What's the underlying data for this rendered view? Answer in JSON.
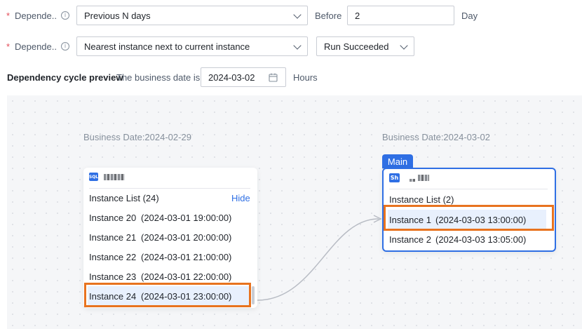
{
  "form": {
    "row1": {
      "required_mark": "*",
      "label": "Depende...",
      "info_icon": "info-icon",
      "select_value": "Previous N days",
      "before_label": "Before",
      "input_value": "2",
      "unit": "Day"
    },
    "row2": {
      "required_mark": "*",
      "label": "Depende...",
      "info_icon": "info-icon",
      "select_value": "Nearest instance next to current instance",
      "status_value": "Run Succeeded"
    },
    "preview": {
      "title": "Dependency cycle preview",
      "business_date_label": "The business date is",
      "date_value": "2024-03-02",
      "calendar_icon": "calendar-icon",
      "hours_label": "Hours"
    }
  },
  "graph": {
    "left_node": {
      "business_date": "Business Date:2024-02-29",
      "type_badge": "SQL",
      "list_title": "Instance List (24)",
      "hide_label": "Hide",
      "instances": [
        {
          "name": "Instance 20",
          "time": "(2024-03-01 19:00:00)"
        },
        {
          "name": "Instance 21",
          "time": "(2024-03-01 20:00:00)"
        },
        {
          "name": "Instance 22",
          "time": "(2024-03-01 21:00:00)"
        },
        {
          "name": "Instance 23",
          "time": "(2024-03-01 22:00:00)"
        },
        {
          "name": "Instance 24",
          "time": "(2024-03-01 23:00:00)"
        }
      ],
      "selected_index": 4
    },
    "right_node": {
      "business_date": "Business Date:2024-03-02",
      "main_tag": "Main",
      "type_badge": "Sh",
      "list_title": "Instance List (2)",
      "instances": [
        {
          "name": "Instance 1",
          "time": "(2024-03-03 13:00:00)"
        },
        {
          "name": "Instance 2",
          "time": "(2024-03-03 13:05:00)"
        }
      ],
      "selected_index": 0
    },
    "colors": {
      "accent": "#2f6fe4",
      "highlight": "#e8731f",
      "selected_bg": "#e8f0fd"
    }
  }
}
